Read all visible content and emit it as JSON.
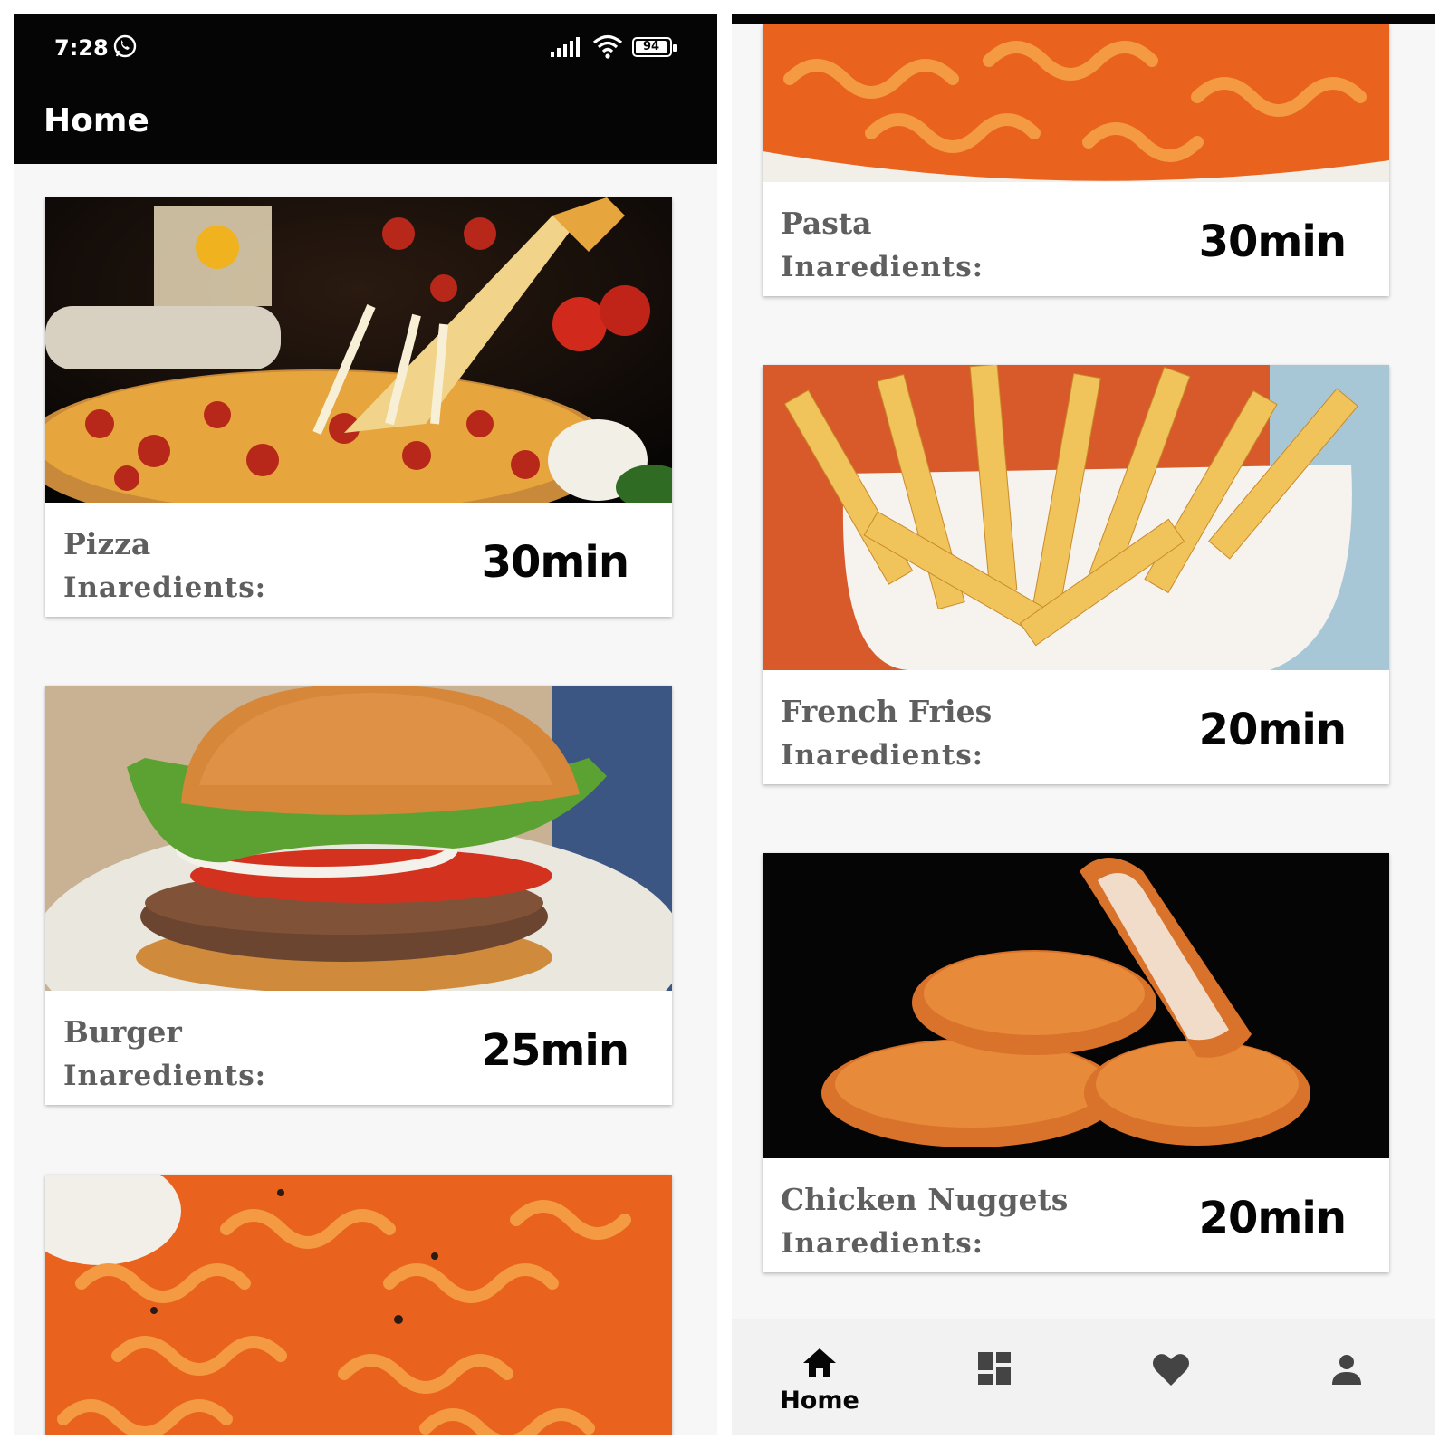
{
  "status_bar": {
    "time": "7:28",
    "battery": "94"
  },
  "app_bar": {
    "title": "Home"
  },
  "recipes": [
    {
      "name": "Pizza",
      "ingredients_label": "Inaredients:",
      "time": "30min"
    },
    {
      "name": "Burger",
      "ingredients_label": "Inaredients:",
      "time": "25min"
    },
    {
      "name": "Pasta",
      "ingredients_label": "Inaredients:",
      "time": "30min"
    },
    {
      "name": "French Fries",
      "ingredients_label": "Inaredients:",
      "time": "20min"
    },
    {
      "name": "Chicken Nuggets",
      "ingredients_label": "Inaredients:",
      "time": "20min"
    }
  ],
  "bottom_nav": {
    "items": [
      {
        "icon": "home-icon",
        "label": "Home",
        "active": true
      },
      {
        "icon": "dashboard-icon",
        "label": ""
      },
      {
        "icon": "heart-icon",
        "label": ""
      },
      {
        "icon": "person-icon",
        "label": ""
      }
    ]
  },
  "colors": {
    "bar": "#050505",
    "card": "#ffffff",
    "background": "#f7f7f7",
    "text_muted": "#5f5f5f"
  }
}
